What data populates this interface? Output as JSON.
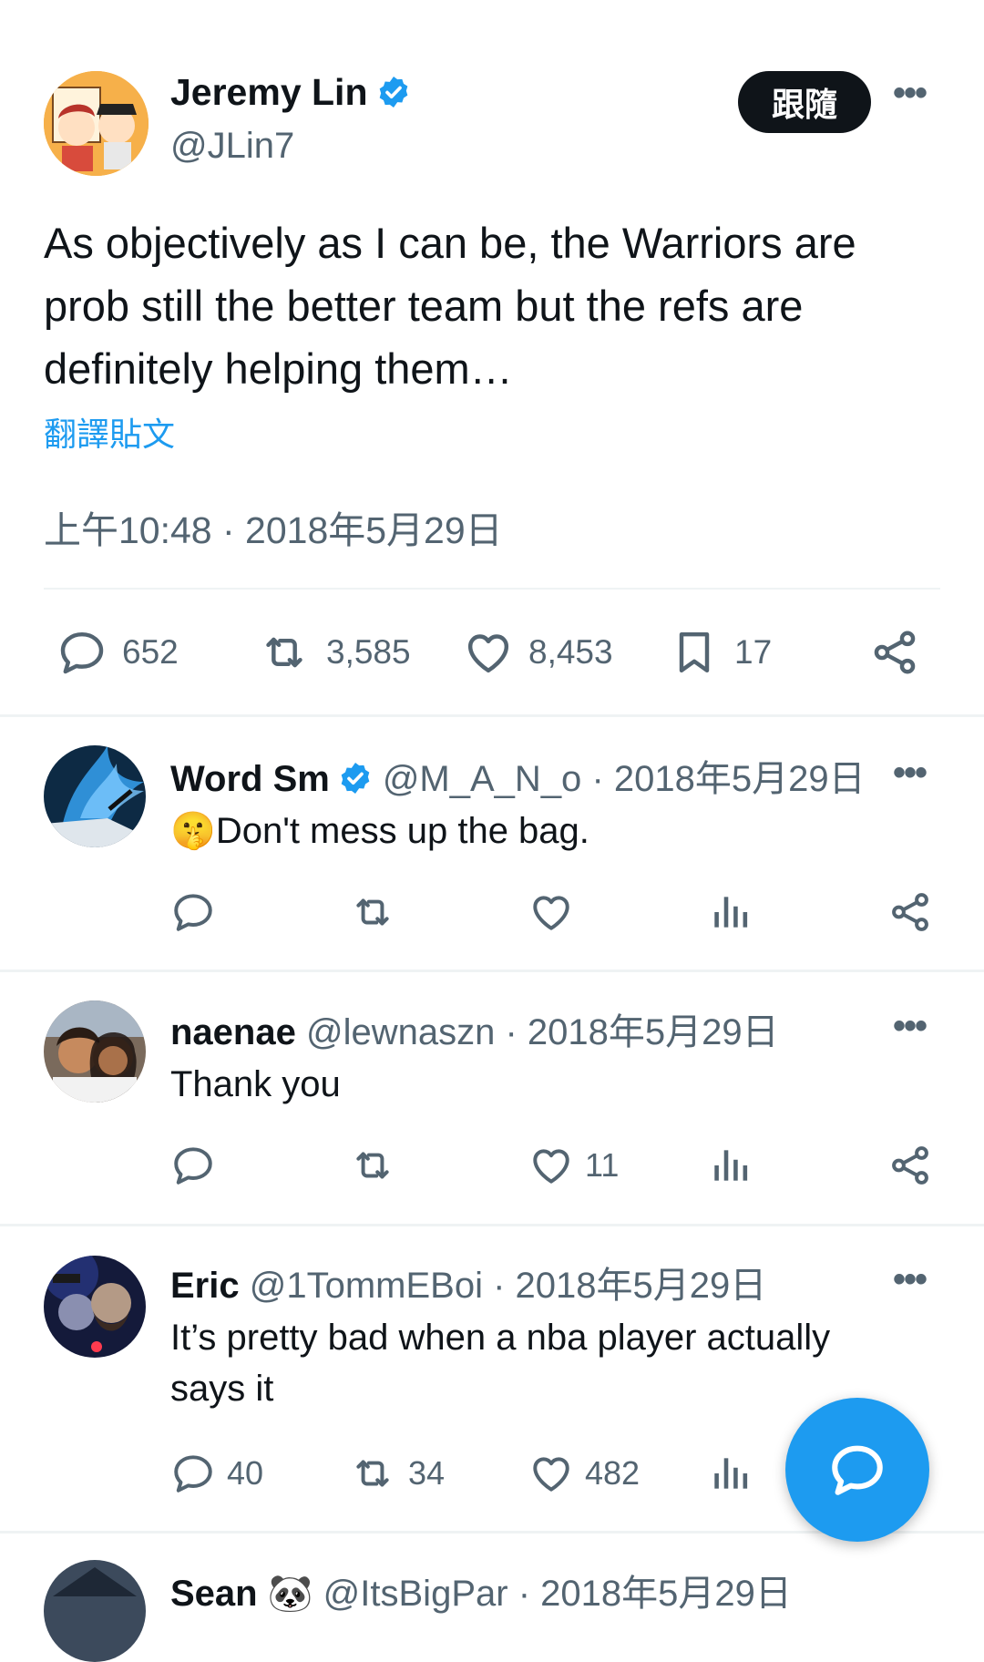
{
  "author": {
    "name": "Jeremy Lin",
    "handle": "@JLin7",
    "follow_label": "跟隨"
  },
  "tweet": {
    "text": "As objectively as I can be, the Warriors are prob still the better team but the refs are definitely helping them…",
    "translate_label": "翻譯貼文",
    "timestamp": "上午10:48 · 2018年5月29日"
  },
  "stats": {
    "replies": "652",
    "retweets": "3,585",
    "likes": "8,453",
    "bookmarks": "17"
  },
  "replies": [
    {
      "name": "Word Sm",
      "handle": "@M_A_N_o",
      "date": "· 2018年5月29日",
      "emoji": "🤫",
      "text": "Don't mess up the bag.",
      "reply_count": "",
      "retweet_count": "",
      "like_count": ""
    },
    {
      "name": "naenae",
      "handle": "@lewnaszn",
      "date": "· 2018年5月29日",
      "text": "Thank you",
      "reply_count": "",
      "retweet_count": "",
      "like_count": "11"
    },
    {
      "name": "Eric",
      "handle": "@1TommEBoi",
      "date": "· 2018年5月29日",
      "text": "It’s pretty bad when a nba player actually says it",
      "reply_count": "40",
      "retweet_count": "34",
      "like_count": "482"
    },
    {
      "name": "Sean",
      "emoji": "🐼",
      "handle": "@ItsBigPar",
      "date": "· 2018年5月29日"
    }
  ],
  "colors": {
    "accent": "#1d9bf0",
    "text": "#0f1419",
    "muted": "#536471"
  }
}
